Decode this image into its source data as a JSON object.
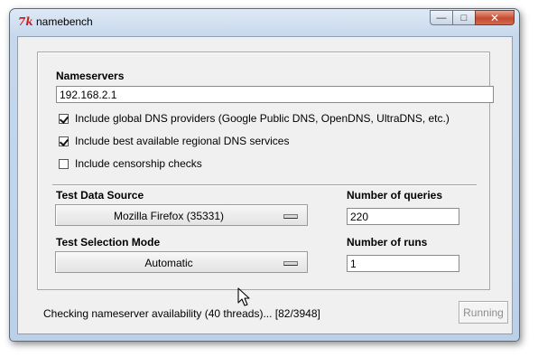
{
  "window": {
    "title": "namebench",
    "icon_text": "7k",
    "minimize_symbol": "—",
    "maximize_symbol": "□",
    "close_symbol": "✕"
  },
  "nameservers": {
    "label": "Nameservers",
    "value": "192.168.2.1"
  },
  "options": [
    {
      "label": "Include global DNS providers (Google Public DNS, OpenDNS, UltraDNS, etc.)",
      "checked": true
    },
    {
      "label": "Include best available regional DNS services",
      "checked": true
    },
    {
      "label": "Include censorship checks",
      "checked": false
    }
  ],
  "test_data_source": {
    "label": "Test Data Source",
    "selected": "Mozilla Firefox (35331)"
  },
  "test_selection_mode": {
    "label": "Test Selection Mode",
    "selected": "Automatic"
  },
  "number_of_queries": {
    "label": "Number of queries",
    "value": "220"
  },
  "number_of_runs": {
    "label": "Number of runs",
    "value": "1"
  },
  "status": {
    "text": "Checking nameserver availability (40 threads)... [82/3948]"
  },
  "action_button": {
    "label": "Running",
    "enabled": false
  }
}
